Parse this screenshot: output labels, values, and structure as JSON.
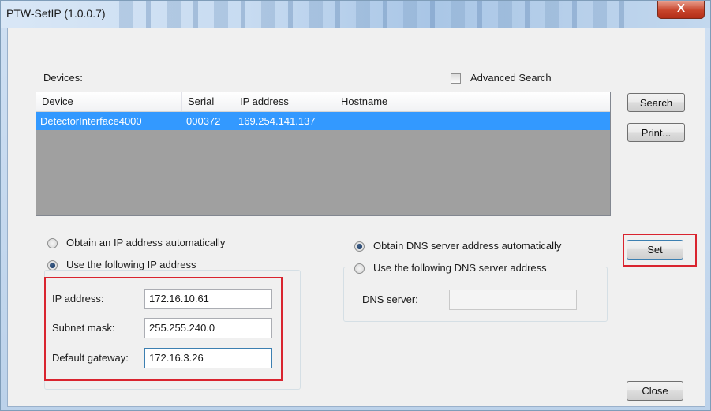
{
  "window": {
    "title": "PTW-SetIP (1.0.0.7)",
    "close_glyph": "X"
  },
  "devices": {
    "label": "Devices:",
    "advanced_search_label": "Advanced Search",
    "advanced_search_checked": false,
    "columns": [
      "Device",
      "Serial",
      "IP address",
      "Hostname"
    ],
    "rows": [
      {
        "device": "DetectorInterface4000",
        "serial": "000372",
        "ip": "169.254.141.137",
        "hostname": "",
        "selected": true
      }
    ]
  },
  "buttons": {
    "search": "Search",
    "print": "Print...",
    "set": "Set",
    "close": "Close"
  },
  "ip_settings": {
    "auto_label": "Obtain an IP address automatically",
    "manual_label": "Use the following IP address",
    "selected": "manual",
    "fields": {
      "ip_label": "IP address:",
      "ip_value": "172.16.10.61",
      "subnet_label": "Subnet mask:",
      "subnet_value": "255.255.240.0",
      "gateway_label": "Default gateway:",
      "gateway_value": "172.16.3.26"
    }
  },
  "dns_settings": {
    "auto_label": "Obtain DNS server address automatically",
    "manual_label": "Use the following DNS server address",
    "selected": "auto",
    "server_label": "DNS server:",
    "server_value": ""
  },
  "colors": {
    "highlight_red": "#d9242f",
    "selection_blue": "#3399ff",
    "list_background": "#a0a0a0"
  }
}
